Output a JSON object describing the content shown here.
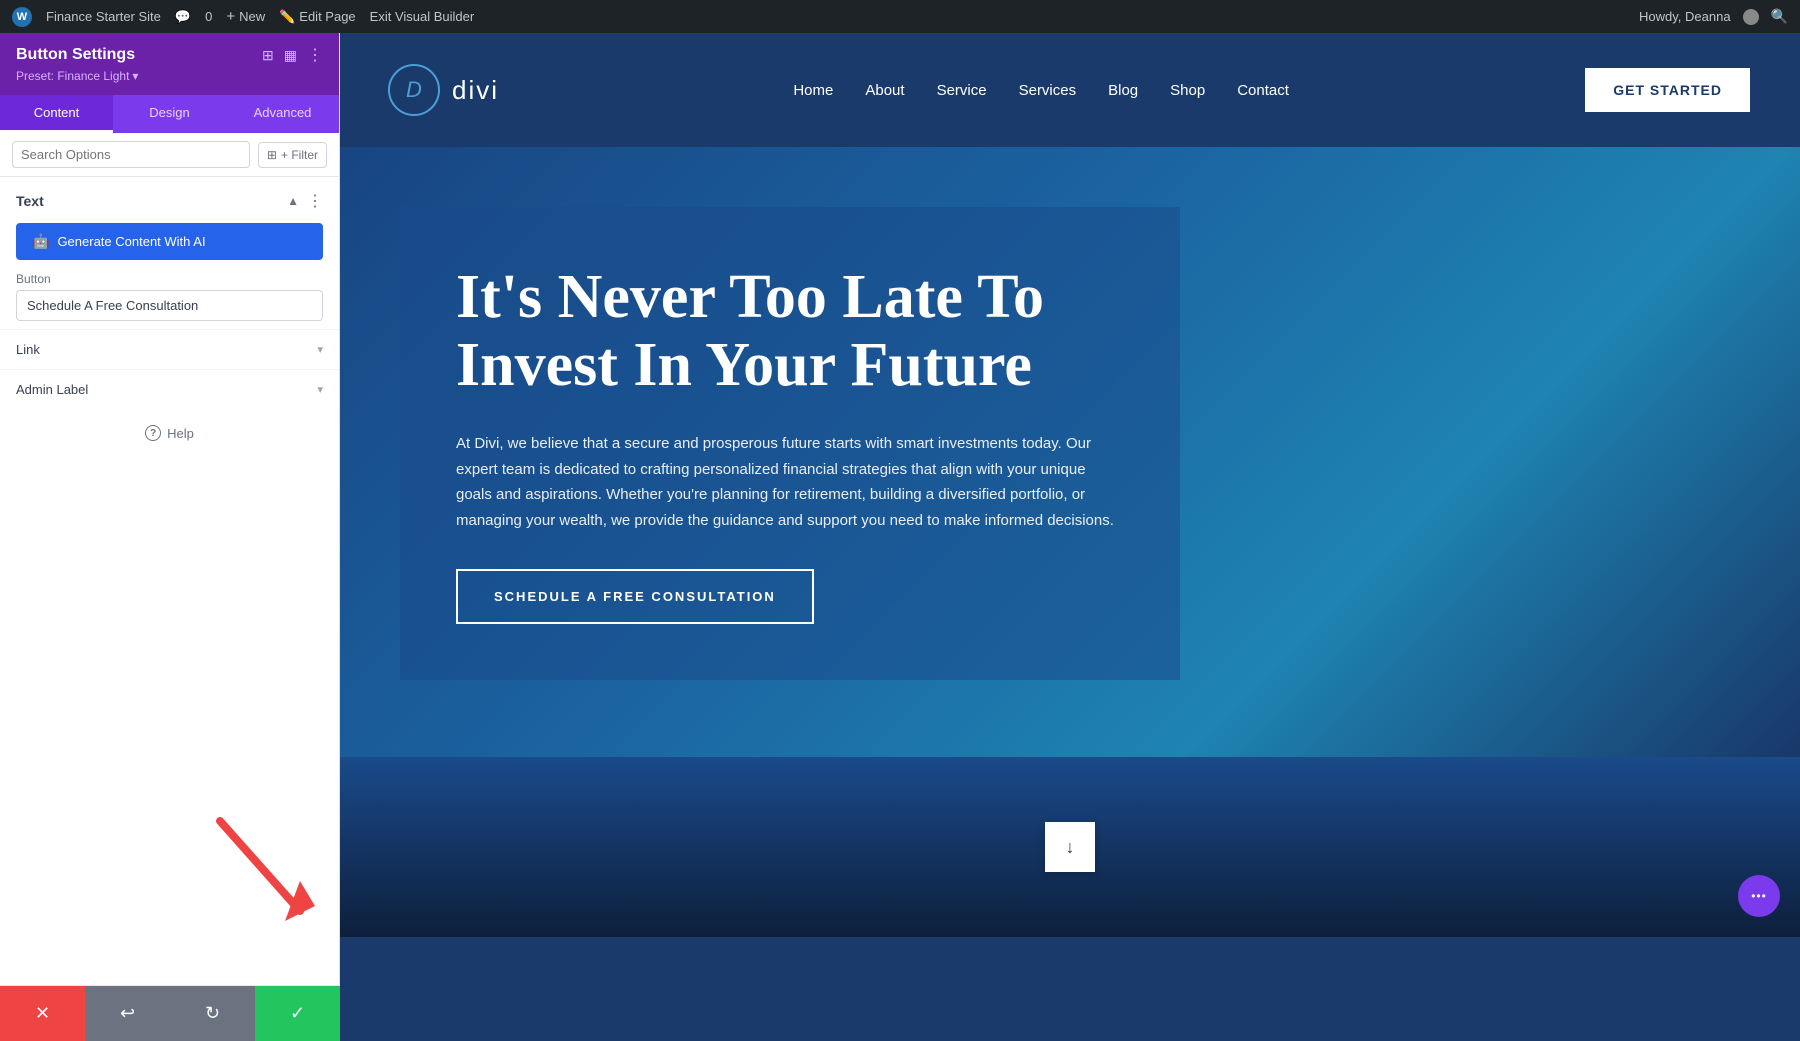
{
  "admin_bar": {
    "site_name": "Finance Starter Site",
    "comment_count": "0",
    "new_label": "New",
    "edit_page_label": "Edit Page",
    "exit_builder_label": "Exit Visual Builder",
    "howdy_label": "Howdy, Deanna"
  },
  "sidebar": {
    "title": "Button Settings",
    "preset_label": "Preset: Finance Light",
    "tabs": [
      {
        "label": "Content",
        "active": true
      },
      {
        "label": "Design",
        "active": false
      },
      {
        "label": "Advanced",
        "active": false
      }
    ],
    "search_placeholder": "Search Options",
    "filter_label": "+ Filter",
    "text_section_title": "Text",
    "ai_btn_label": "Generate Content With AI",
    "button_field_label": "Button",
    "button_value": "Schedule A Free Consultation",
    "link_section_label": "Link",
    "admin_label_section": "Admin Label",
    "help_label": "Help",
    "bottom_buttons": [
      {
        "label": "✕",
        "type": "close"
      },
      {
        "label": "↩",
        "type": "undo"
      },
      {
        "label": "↻",
        "type": "redo"
      },
      {
        "label": "✓",
        "type": "save"
      }
    ]
  },
  "website": {
    "logo_letter": "D",
    "logo_name": "divi",
    "nav_links": [
      "Home",
      "About",
      "Service",
      "Services",
      "Blog",
      "Shop",
      "Contact"
    ],
    "cta_label": "GET STARTED",
    "hero_title": "It's Never Too Late To Invest In Your Future",
    "hero_body": "At Divi, we believe that a secure and prosperous future starts with smart investments today. Our expert team is dedicated to crafting personalized financial strategies that align with your unique goals and aspirations. Whether you're planning for retirement, building a diversified portfolio, or managing your wealth, we provide the guidance and support you need to make informed decisions.",
    "hero_cta": "SCHEDULE A FREE CONSULTATION",
    "scroll_down_label": "↓",
    "dots_label": "•••"
  }
}
